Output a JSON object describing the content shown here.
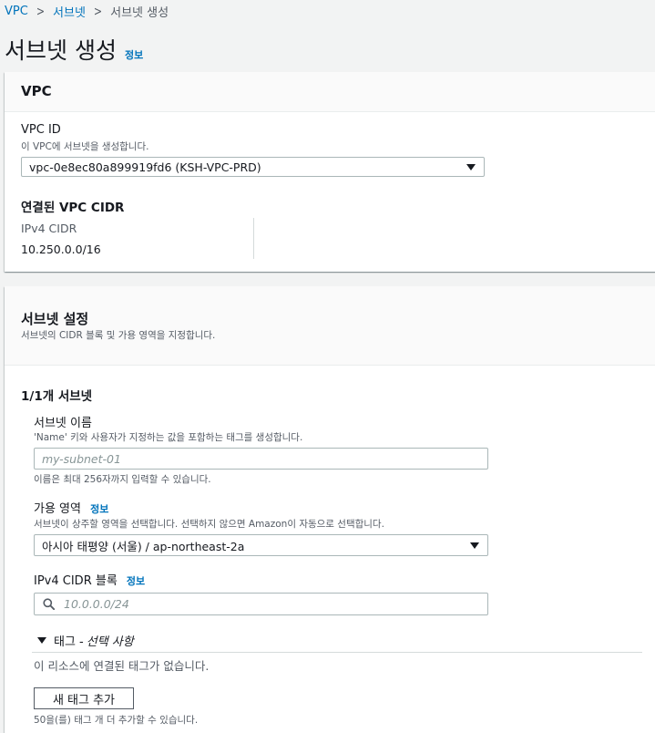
{
  "breadcrumb": {
    "items": [
      "VPC",
      "서브넷"
    ],
    "current": "서브넷 생성"
  },
  "page": {
    "title": "서브넷 생성",
    "info": "정보"
  },
  "vpc_section": {
    "title": "VPC",
    "vpc_id_label": "VPC ID",
    "vpc_id_desc": "이 VPC에 서브넷을 생성합니다.",
    "vpc_id_value": "vpc-0e8ec80a899919fd6 (KSH-VPC-PRD)",
    "cidr_heading": "연결된 VPC CIDR",
    "ipv4_label": "IPv4 CIDR",
    "ipv4_value": "10.250.0.0/16"
  },
  "subnet_section": {
    "title": "서브넷 설정",
    "desc": "서브넷의 CIDR 블록 및 가용 영역을 지정합니다.",
    "count": "1/1개 서브넷",
    "name_label": "서브넷 이름",
    "name_desc": "'Name' 키와 사용자가 지정하는 값을 포함하는 태그를 생성합니다.",
    "name_placeholder": "my-subnet-01",
    "name_hint": "이름은 최대 256자까지 입력할 수 있습니다.",
    "az_label": "가용 영역",
    "az_info": "정보",
    "az_desc": "서브넷이 상주할 영역을 선택합니다. 선택하지 않으면 Amazon이 자동으로 선택합니다.",
    "az_value": "아시아 태평양 (서울) / ap-northeast-2a",
    "cidr_label": "IPv4 CIDR 블록",
    "cidr_info": "정보",
    "cidr_placeholder": "10.0.0.0/24",
    "tags_label": "태그 - ",
    "tags_optional": "선택 사항",
    "tags_empty": "이 리소스에 연결된 태그가 없습니다.",
    "add_tag_button": "새 태그 추가",
    "tags_hint": "50을(를) 태그 개 더 추가할 수 있습니다."
  }
}
